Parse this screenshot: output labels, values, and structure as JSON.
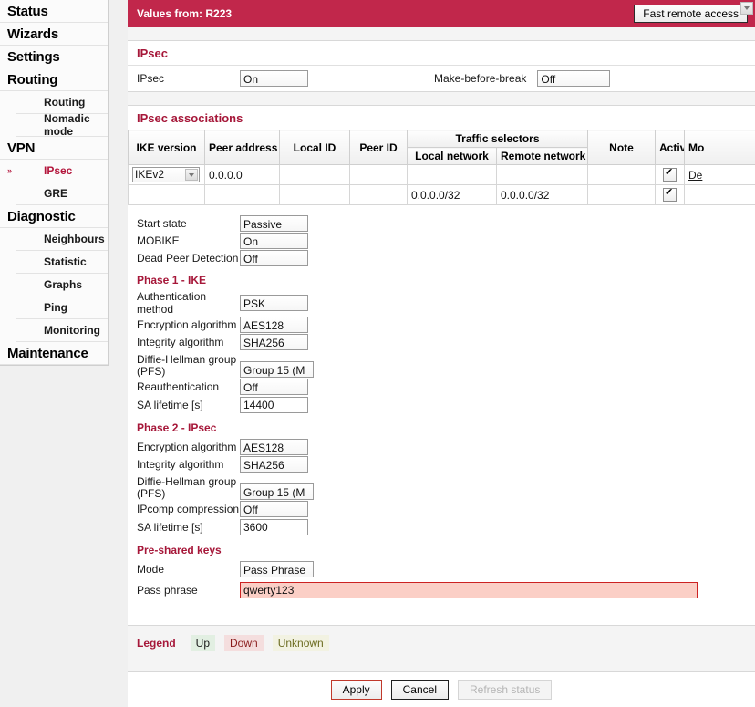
{
  "sidebar": {
    "items": [
      {
        "label": "Status",
        "level": "main",
        "active": false
      },
      {
        "label": "Wizards",
        "level": "main",
        "active": false
      },
      {
        "label": "Settings",
        "level": "main",
        "active": false
      },
      {
        "label": "Routing",
        "level": "main",
        "active": false
      },
      {
        "label": "Routing",
        "level": "sub",
        "active": false
      },
      {
        "label": "Nomadic mode",
        "level": "sub",
        "active": false
      },
      {
        "label": "VPN",
        "level": "main",
        "active": false
      },
      {
        "label": "IPsec",
        "level": "sub",
        "active": true
      },
      {
        "label": "GRE",
        "level": "sub",
        "active": false
      },
      {
        "label": "Diagnostic",
        "level": "main",
        "active": false
      },
      {
        "label": "Neighbours",
        "level": "sub",
        "active": false
      },
      {
        "label": "Statistic",
        "level": "sub",
        "active": false
      },
      {
        "label": "Graphs",
        "level": "sub",
        "active": false
      },
      {
        "label": "Ping",
        "level": "sub",
        "active": false
      },
      {
        "label": "Monitoring",
        "level": "sub",
        "active": false
      },
      {
        "label": "Maintenance",
        "level": "main",
        "active": false
      }
    ]
  },
  "topbar": {
    "values_from": "Values from: R223",
    "fast_remote_access": "Fast remote access",
    "accent_color": "#c1274b"
  },
  "ipsec_panel": {
    "title": "IPsec",
    "ipsec_label": "IPsec",
    "ipsec_value": "On",
    "make_before_break_label": "Make-before-break",
    "make_before_break_value": "Off"
  },
  "associations": {
    "title": "IPsec associations",
    "group_header": "Traffic selectors",
    "columns": {
      "ike_version": "IKE version",
      "peer_address": "Peer address",
      "local_id": "Local ID",
      "peer_id": "Peer ID",
      "local_network": "Local network",
      "remote_network": "Remote network",
      "note": "Note",
      "active": "Active",
      "more": "Mo"
    },
    "rows": [
      {
        "ike_version": "IKEv2",
        "peer_address": "0.0.0.0",
        "local_id": "",
        "peer_id": "",
        "local_network": "",
        "remote_network": "",
        "note": "",
        "active": true,
        "action": "De",
        "status": "down"
      },
      {
        "ike_version": "",
        "peer_address": "",
        "local_id": "",
        "peer_id": "",
        "local_network": "0.0.0.0/32",
        "remote_network": "0.0.0.0/32",
        "note": "",
        "active": true,
        "action": "",
        "status": "normal"
      }
    ]
  },
  "general": {
    "start_state_label": "Start state",
    "start_state_value": "Passive",
    "mobike_label": "MOBIKE",
    "mobike_value": "On",
    "dpd_label": "Dead Peer Detection",
    "dpd_value": "Off"
  },
  "phase1": {
    "title": "Phase 1 - IKE",
    "auth_method_label": "Authentication method",
    "auth_method_value": "PSK",
    "encryption_label": "Encryption algorithm",
    "encryption_value": "AES128",
    "integrity_label": "Integrity algorithm",
    "integrity_value": "SHA256",
    "dh_label_line1": "Diffie-Hellman group",
    "dh_label_line2": "(PFS)",
    "dh_value": "Group 15 (M",
    "reauth_label": "Reauthentication",
    "reauth_value": "Off",
    "sa_lifetime_label": "SA lifetime [s]",
    "sa_lifetime_value": "14400"
  },
  "phase2": {
    "title": "Phase 2 - IPsec",
    "encryption_label": "Encryption algorithm",
    "encryption_value": "AES128",
    "integrity_label": "Integrity algorithm",
    "integrity_value": "SHA256",
    "dh_label_line1": "Diffie-Hellman group",
    "dh_label_line2": "(PFS)",
    "dh_value": "Group 15 (M",
    "ipcomp_label": "IPcomp compression",
    "ipcomp_value": "Off",
    "sa_lifetime_label": "SA lifetime [s]",
    "sa_lifetime_value": "3600"
  },
  "preshared": {
    "title": "Pre-shared keys",
    "mode_label": "Mode",
    "mode_value": "Pass Phrase",
    "passphrase_label": "Pass phrase",
    "passphrase_value": "qwerty123"
  },
  "legend": {
    "title": "Legend",
    "up": "Up",
    "down": "Down",
    "unknown": "Unknown"
  },
  "footer": {
    "apply": "Apply",
    "cancel": "Cancel",
    "refresh": "Refresh status"
  }
}
